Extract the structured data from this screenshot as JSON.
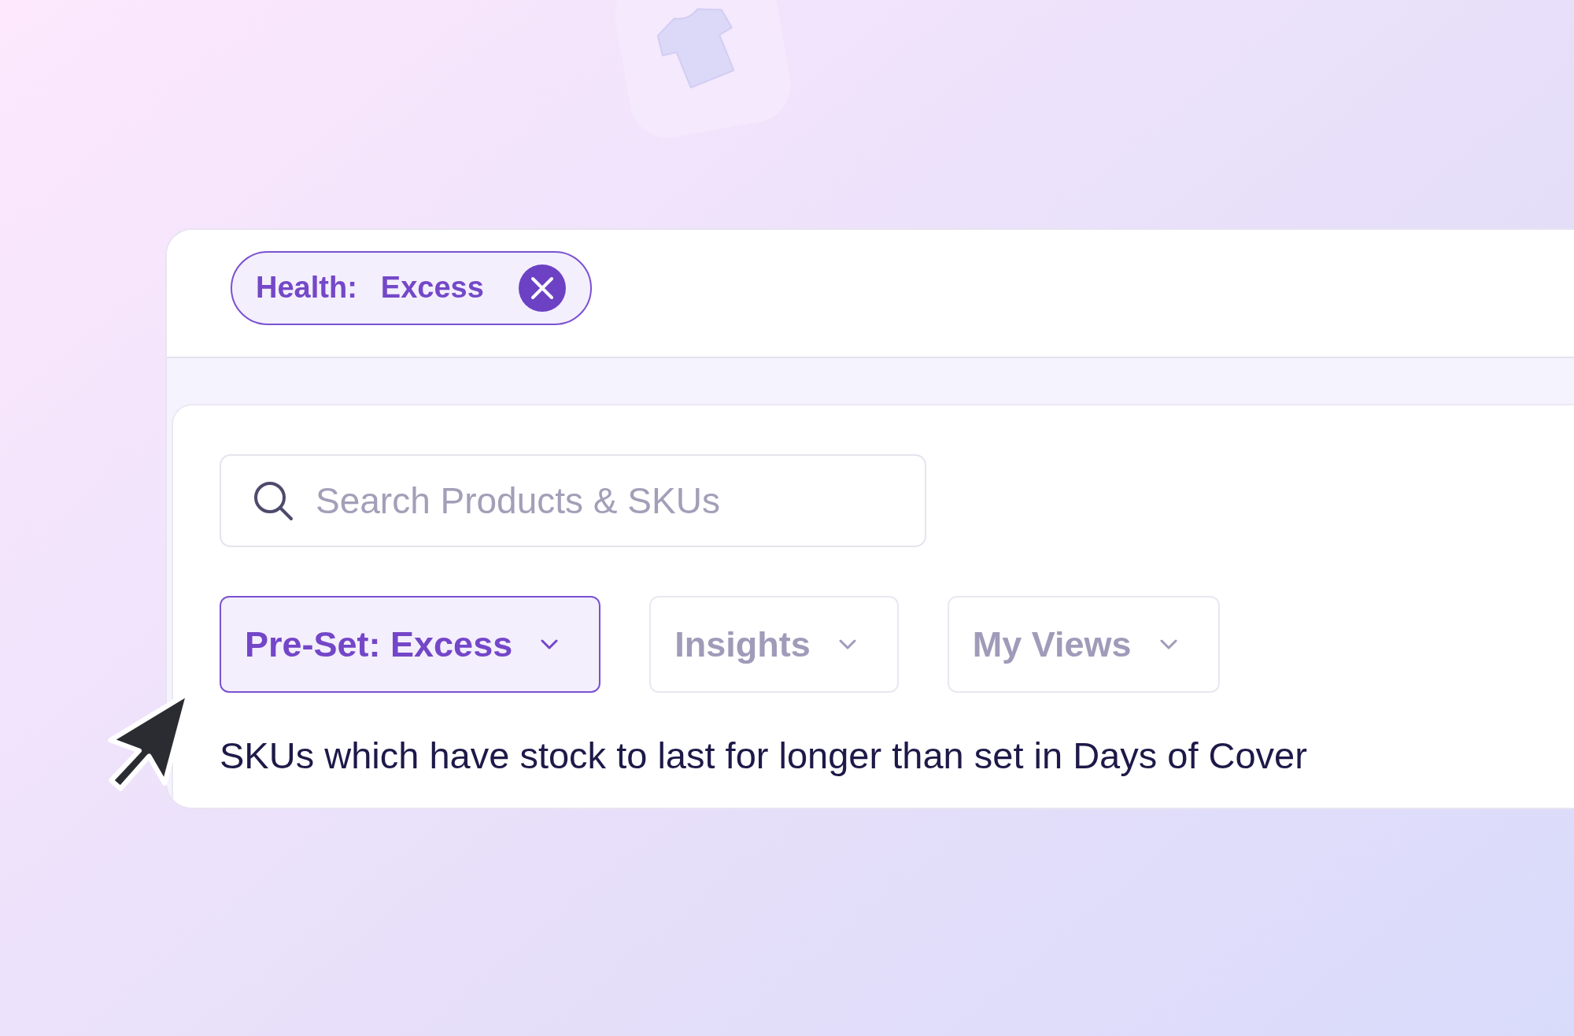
{
  "filter_chips": [
    {
      "label": "Health:",
      "value": "Excess"
    }
  ],
  "search": {
    "placeholder": "Search Products & SKUs"
  },
  "dropdowns": [
    {
      "label": "Pre-Set: Excess",
      "selected": true
    },
    {
      "label": "Insights",
      "selected": false
    },
    {
      "label": "My Views",
      "selected": false
    }
  ],
  "description": "SKUs which have stock to last for longer than set in Days of Cover"
}
